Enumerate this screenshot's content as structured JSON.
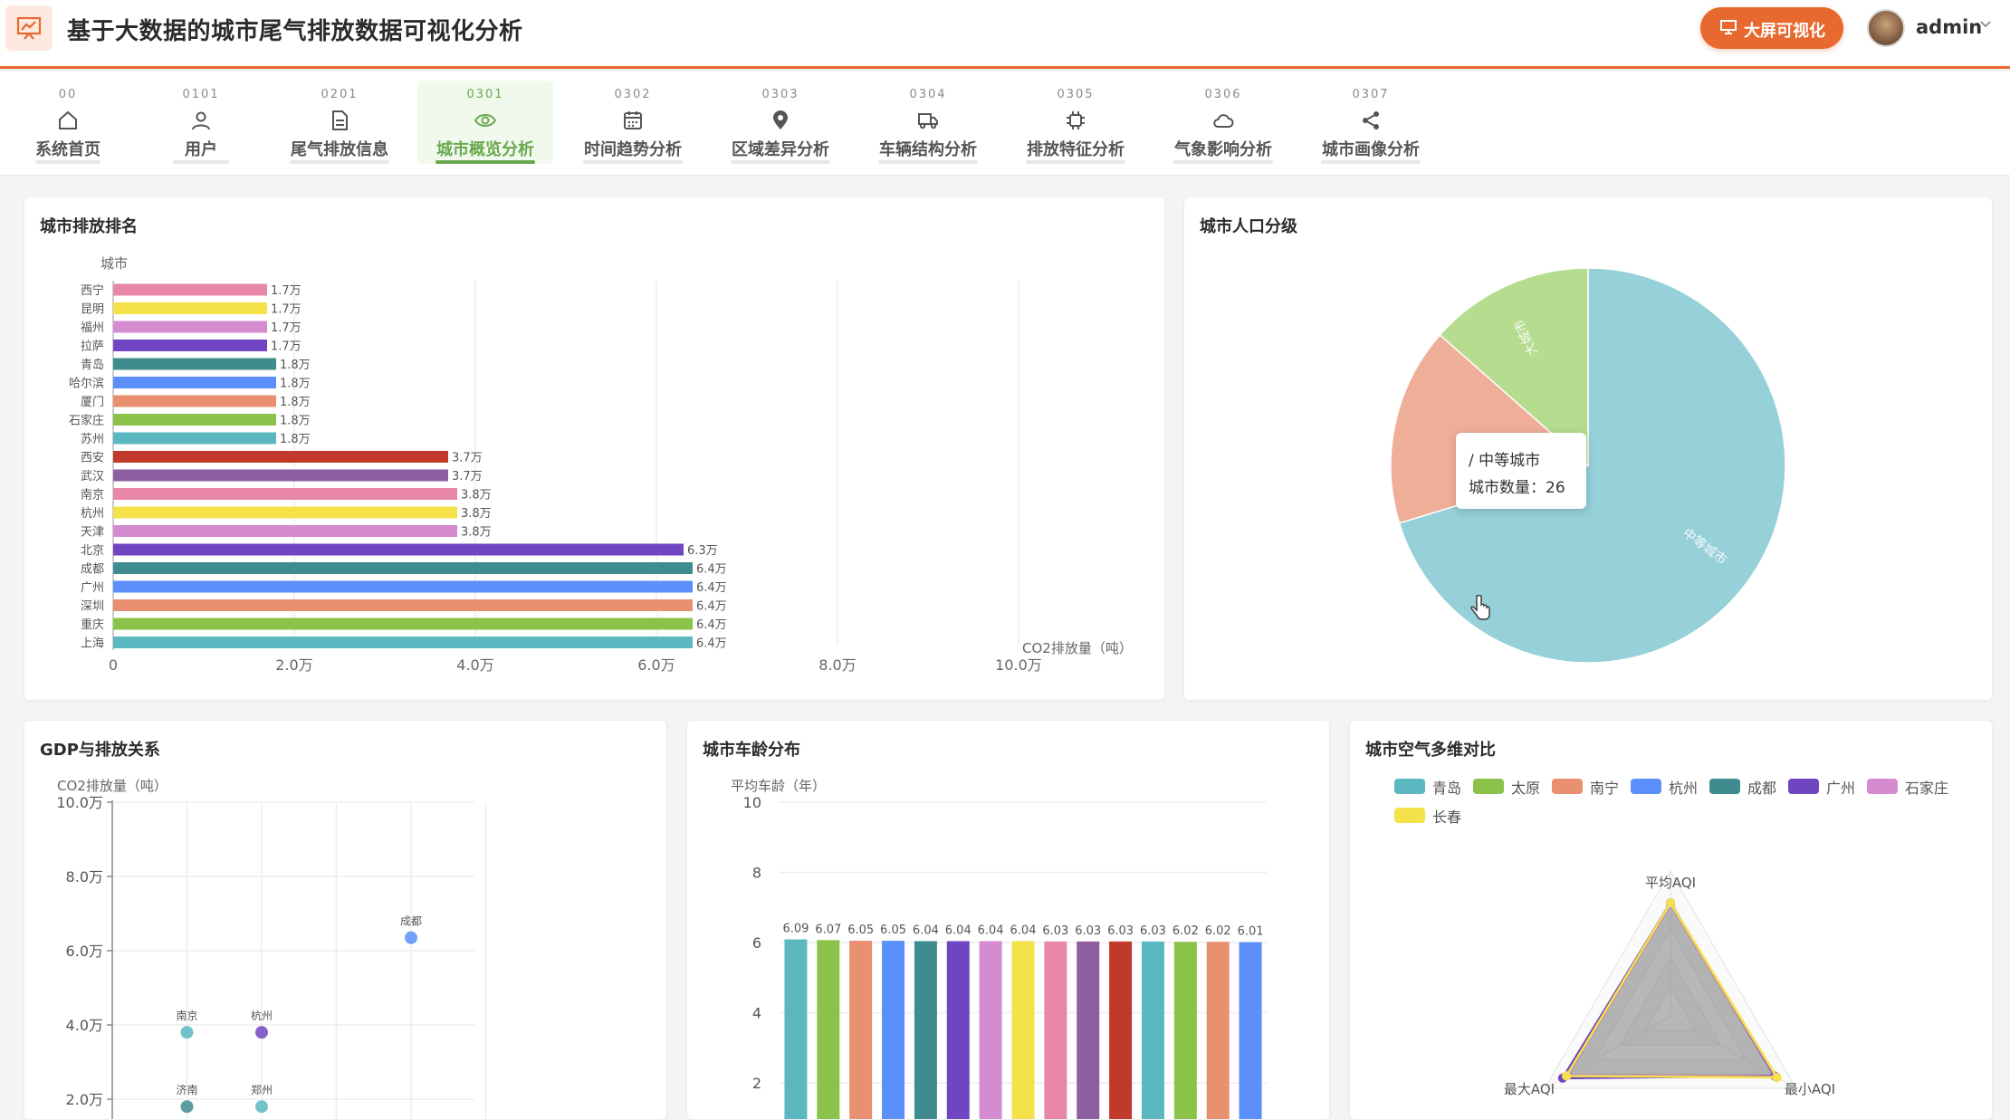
{
  "app": {
    "title": "基于大数据的城市尾气排放数据可视化分析"
  },
  "header": {
    "bigscreen_label": "大屏可视化",
    "user_name": "admin"
  },
  "nav": [
    {
      "code": "00",
      "label": "系统首页",
      "icon": "home-icon",
      "active": false
    },
    {
      "code": "0101",
      "label": "用户",
      "icon": "user-icon",
      "active": false
    },
    {
      "code": "0201",
      "label": "尾气排放信息",
      "icon": "document-icon",
      "active": false
    },
    {
      "code": "0301",
      "label": "城市概览分析",
      "icon": "eye-icon",
      "active": true
    },
    {
      "code": "0302",
      "label": "时间趋势分析",
      "icon": "calendar-icon",
      "active": false
    },
    {
      "code": "0303",
      "label": "区域差异分析",
      "icon": "location-pin-icon",
      "active": false
    },
    {
      "code": "0304",
      "label": "车辆结构分析",
      "icon": "truck-icon",
      "active": false
    },
    {
      "code": "0305",
      "label": "排放特征分析",
      "icon": "chip-icon",
      "active": false
    },
    {
      "code": "0306",
      "label": "气象影响分析",
      "icon": "cloud-icon",
      "active": false
    },
    {
      "code": "0307",
      "label": "城市画像分析",
      "icon": "share-icon",
      "active": false
    }
  ],
  "colors": {
    "accent": "#e8692f",
    "active": "#6aa84f",
    "palette": [
      "#5bb7c0",
      "#8bc34a",
      "#e8906f",
      "#5b8ff9",
      "#3f8c8e",
      "#7045c2",
      "#d48bd0",
      "#f5e14a",
      "#e887a8",
      "#8e5ea2",
      "#c0392b"
    ]
  },
  "chart_data": [
    {
      "type": "bar",
      "title": "城市排放排名",
      "orientation": "horizontal",
      "ylabel": "城市",
      "xlabel": "CO2排放量（吨）",
      "xlim": [
        0,
        100000
      ],
      "xticks": [
        "0",
        "2.0万",
        "4.0万",
        "6.0万",
        "8.0万",
        "10.0万"
      ],
      "categories": [
        "西宁",
        "昆明",
        "福州",
        "拉萨",
        "青岛",
        "哈尔滨",
        "厦门",
        "石家庄",
        "苏州",
        "西安",
        "武汉",
        "南京",
        "杭州",
        "天津",
        "北京",
        "成都",
        "广州",
        "深圳",
        "重庆",
        "上海"
      ],
      "values": [
        17000,
        17000,
        17000,
        17000,
        18000,
        18000,
        18000,
        18000,
        18000,
        37000,
        37000,
        38000,
        38000,
        38000,
        63000,
        64000,
        64000,
        64000,
        64000,
        64000
      ],
      "labels": [
        "1.7万",
        "1.7万",
        "1.7万",
        "1.7万",
        "1.8万",
        "1.8万",
        "1.8万",
        "1.8万",
        "1.8万",
        "3.7万",
        "3.7万",
        "3.8万",
        "3.8万",
        "3.8万",
        "6.3万",
        "6.4万",
        "6.4万",
        "6.4万",
        "6.4万",
        "6.4万"
      ],
      "bar_colors": [
        "#e887a8",
        "#f5e14a",
        "#d48bd0",
        "#7045c2",
        "#3f8c8e",
        "#5b8ff9",
        "#e8906f",
        "#8bc34a",
        "#5bb7c0",
        "#c0392b",
        "#8e5ea2",
        "#e887a8",
        "#f5e14a",
        "#d48bd0",
        "#7045c2",
        "#3f8c8e",
        "#5b8ff9",
        "#e8906f",
        "#8bc34a",
        "#5bb7c0"
      ]
    },
    {
      "type": "pie",
      "title": "城市人口分级",
      "slices": [
        {
          "name": "中等城市",
          "value": 26,
          "color": "#96d0d8",
          "label": "中等城市"
        },
        {
          "name": "",
          "value": 6,
          "color": "#efae98",
          "label": ""
        },
        {
          "name": "大城市",
          "value": 5,
          "color": "#b5dc8f",
          "label": "大城市"
        }
      ],
      "tooltip": {
        "series": "/ 中等城市",
        "text": "城市数量：26"
      }
    },
    {
      "type": "scatter",
      "title": "GDP与排放关系",
      "ylabel": "CO2排放量（吨）",
      "ylim": [
        20000,
        100000
      ],
      "yticks": [
        "2.0万",
        "4.0万",
        "6.0万",
        "8.0万",
        "10.0万"
      ],
      "points": [
        {
          "name": "南京",
          "xi": 1,
          "y": 38000,
          "color": "#5bb7c0"
        },
        {
          "name": "杭州",
          "xi": 2,
          "y": 38000,
          "color": "#7045c2"
        },
        {
          "name": "成都",
          "xi": 4,
          "y": 63500,
          "color": "#5b8ff9"
        },
        {
          "name": "济南",
          "xi": 1,
          "y": 18000,
          "color": "#3f8c8e"
        },
        {
          "name": "郑州",
          "xi": 2,
          "y": 18000,
          "color": "#5bb7c0"
        }
      ]
    },
    {
      "type": "bar",
      "title": "城市车龄分布",
      "ylabel": "平均车龄（年）",
      "ylim": [
        0,
        10
      ],
      "yticks": [
        "2",
        "4",
        "6",
        "8",
        "10"
      ],
      "values": [
        6.09,
        6.07,
        6.05,
        6.05,
        6.04,
        6.04,
        6.04,
        6.04,
        6.03,
        6.03,
        6.03,
        6.03,
        6.02,
        6.02,
        6.01
      ],
      "labels": [
        "6.09",
        "6.07",
        "6.05",
        "6.05",
        "6.04",
        "6.04",
        "6.04",
        "6.04",
        "6.03",
        "6.03",
        "6.03",
        "6.03",
        "6.02",
        "6.02",
        "6.01"
      ],
      "bar_colors": [
        "#5bb7c0",
        "#8bc34a",
        "#e8906f",
        "#5b8ff9",
        "#3f8c8e",
        "#7045c2",
        "#d48bd0",
        "#f5e14a",
        "#e887a8",
        "#8e5ea2",
        "#c0392b",
        "#5bb7c0",
        "#8bc34a",
        "#e8906f",
        "#5b8ff9"
      ]
    },
    {
      "type": "radar",
      "title": "城市空气多维对比",
      "indicators": [
        "平均AQI",
        "最大AQI",
        "最小AQI"
      ],
      "series": [
        {
          "name": "青岛",
          "color": "#5bb7c0"
        },
        {
          "name": "太原",
          "color": "#8bc34a"
        },
        {
          "name": "南宁",
          "color": "#e8906f"
        },
        {
          "name": "杭州",
          "color": "#5b8ff9"
        },
        {
          "name": "成都",
          "color": "#3f8c8e"
        },
        {
          "name": "广州",
          "color": "#7045c2"
        },
        {
          "name": "石家庄",
          "color": "#d48bd0"
        },
        {
          "name": "长春",
          "color": "#f5e14a"
        }
      ]
    }
  ]
}
